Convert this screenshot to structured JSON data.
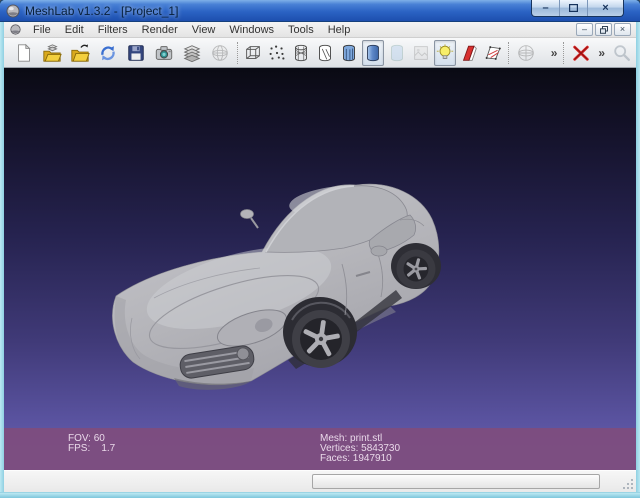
{
  "window_title": "MeshLab v1.3.2 - [Project_1]",
  "titlebar": {
    "minimize_glyph": "–",
    "close_glyph": "×"
  },
  "menubar": {
    "items": [
      "File",
      "Edit",
      "Filters",
      "Render",
      "View",
      "Windows",
      "Tools",
      "Help"
    ],
    "mdi": {
      "minimize_glyph": "–",
      "close_glyph": "×"
    }
  },
  "toolbar": {
    "chevron": "»",
    "buttons": [
      {
        "name": "new-empty-project",
        "state": "normal"
      },
      {
        "name": "open-project",
        "state": "normal"
      },
      {
        "name": "import-mesh",
        "state": "normal"
      },
      {
        "name": "reload-mesh",
        "state": "normal"
      },
      {
        "name": "export-mesh",
        "state": "normal"
      },
      {
        "name": "snapshot",
        "state": "normal"
      },
      {
        "name": "show-layer-dialog",
        "state": "normal"
      },
      {
        "name": "show-trackball",
        "state": "disabled"
      },
      {
        "name": "render-bounding-box",
        "state": "normal"
      },
      {
        "name": "render-points",
        "state": "normal"
      },
      {
        "name": "render-wireframe",
        "state": "normal"
      },
      {
        "name": "render-hidden-lines",
        "state": "normal"
      },
      {
        "name": "render-flat-lines",
        "state": "normal"
      },
      {
        "name": "render-smooth",
        "state": "pressed"
      },
      {
        "name": "render-flat",
        "state": "disabled"
      },
      {
        "name": "render-texture",
        "state": "disabled"
      },
      {
        "name": "light-toggle",
        "state": "pressed"
      },
      {
        "name": "backface-culling",
        "state": "normal"
      },
      {
        "name": "selected-face-rendering",
        "state": "normal"
      },
      {
        "name": "trackball-globe",
        "state": "disabled"
      },
      {
        "name": "delete-current-mesh",
        "state": "normal"
      },
      {
        "name": "search",
        "state": "disabled"
      }
    ]
  },
  "viewport": {
    "overlay": {
      "left": [
        "FOV: 60",
        "FPS:    1.7"
      ],
      "right": [
        "Mesh: print.stl",
        "Vertices: 5843730",
        "Faces: 1947910"
      ]
    }
  },
  "colors": {
    "titlebar_blue": "#2b63c4",
    "viewport_top": "#0a0a13",
    "viewport_bottom": "#6b64ae",
    "overlay_band": "#7d4d7e",
    "folder_yellow": "#eec53c",
    "render_blue": "#7fa8dc",
    "delete_red": "#d82424"
  }
}
